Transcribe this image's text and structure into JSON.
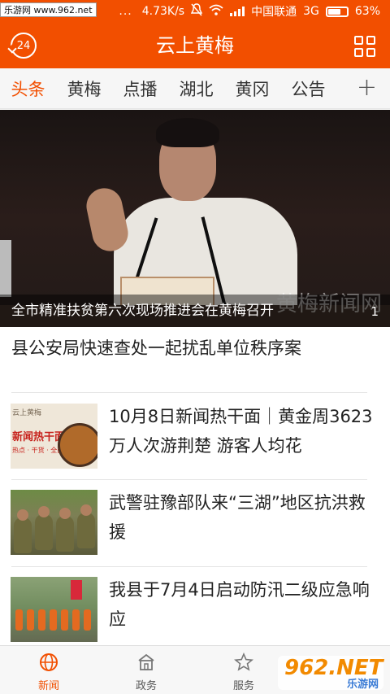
{
  "status_bar": {
    "watermark": "乐游网 www.962.net",
    "dots": "...",
    "speed": "4.73K/s",
    "carrier": "中国联通",
    "network": "3G",
    "battery": "63%"
  },
  "app_bar": {
    "title": "云上黄梅",
    "clock_number": "24",
    "color": "#f24f00"
  },
  "tabs": {
    "items": [
      "头条",
      "黄梅",
      "点播",
      "湖北",
      "黄冈",
      "公告"
    ],
    "active_index": 0,
    "add_label": "+"
  },
  "hero": {
    "caption": "全市精准扶贫第六次现场推进会在黄梅召开",
    "page_indicator": "1",
    "watermark": "黄梅新闻网"
  },
  "headline": "县公安局快速查处一起扰乱单位秩序案",
  "news": [
    {
      "title": "10月8日新闻热干面｜黄金周3623万人次游荆楚 游客人均花",
      "thumb_text": "新闻热干面",
      "thumb_small": "热点 · 干货 · 全面",
      "thumb_top": "云上黄梅"
    },
    {
      "title": "武警驻豫部队来“三湖”地区抗洪救援"
    },
    {
      "title": "我县于7月4日启动防汛二级应急响应"
    }
  ],
  "bottom_nav": {
    "items": [
      "新闻",
      "政务",
      "服务",
      ""
    ],
    "active_index": 0
  },
  "site_watermark": {
    "big": "962.NET",
    "small": "乐游网"
  }
}
